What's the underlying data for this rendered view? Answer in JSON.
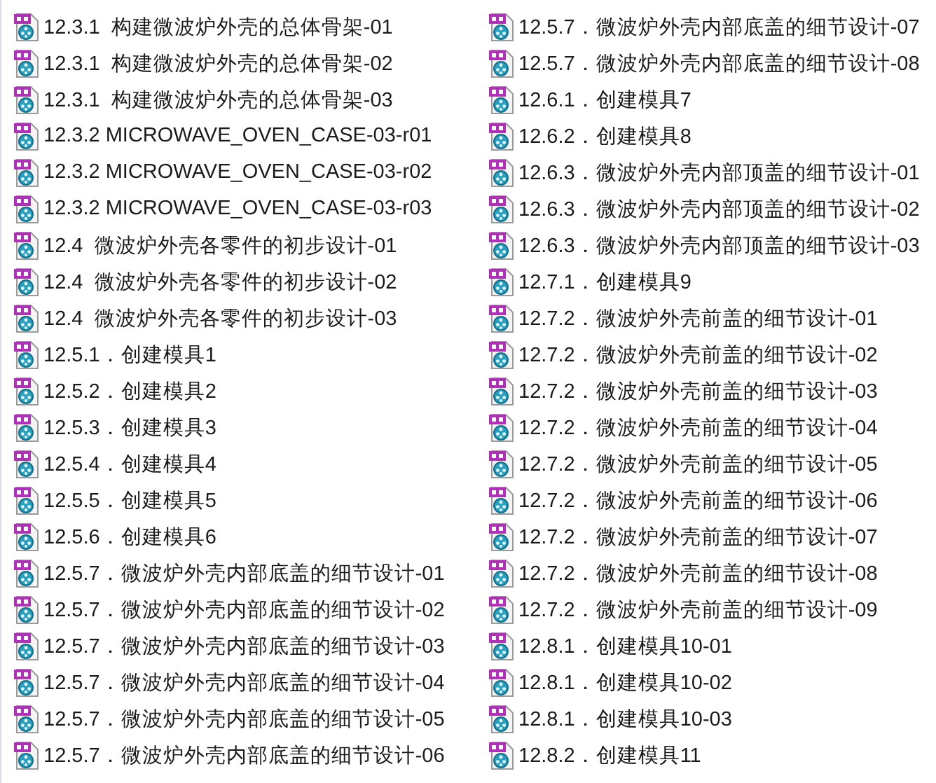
{
  "files": [
    {
      "name": "12.3.1  构建微波炉外壳的总体骨架-01"
    },
    {
      "name": "12.3.1  构建微波炉外壳的总体骨架-02"
    },
    {
      "name": "12.3.1  构建微波炉外壳的总体骨架-03"
    },
    {
      "name": "12.3.2 MICROWAVE_OVEN_CASE-03-r01"
    },
    {
      "name": "12.3.2 MICROWAVE_OVEN_CASE-03-r02"
    },
    {
      "name": "12.3.2 MICROWAVE_OVEN_CASE-03-r03"
    },
    {
      "name": "12.4  微波炉外壳各零件的初步设计-01"
    },
    {
      "name": "12.4  微波炉外壳各零件的初步设计-02"
    },
    {
      "name": "12.4  微波炉外壳各零件的初步设计-03"
    },
    {
      "name": "12.5.1．创建模具1"
    },
    {
      "name": "12.5.2．创建模具2"
    },
    {
      "name": "12.5.3．创建模具3"
    },
    {
      "name": "12.5.4．创建模具4"
    },
    {
      "name": "12.5.5．创建模具5"
    },
    {
      "name": "12.5.6．创建模具6"
    },
    {
      "name": "12.5.7．微波炉外壳内部底盖的细节设计-01"
    },
    {
      "name": "12.5.7．微波炉外壳内部底盖的细节设计-02"
    },
    {
      "name": "12.5.7．微波炉外壳内部底盖的细节设计-03"
    },
    {
      "name": "12.5.7．微波炉外壳内部底盖的细节设计-04"
    },
    {
      "name": "12.5.7．微波炉外壳内部底盖的细节设计-05"
    },
    {
      "name": "12.5.7．微波炉外壳内部底盖的细节设计-06"
    },
    {
      "name": "12.5.7．微波炉外壳内部底盖的细节设计-07"
    },
    {
      "name": "12.5.7．微波炉外壳内部底盖的细节设计-08"
    },
    {
      "name": "12.6.1．创建模具7"
    },
    {
      "name": "12.6.2．创建模具8"
    },
    {
      "name": "12.6.3．微波炉外壳内部顶盖的细节设计-01"
    },
    {
      "name": "12.6.3．微波炉外壳内部顶盖的细节设计-02"
    },
    {
      "name": "12.6.3．微波炉外壳内部顶盖的细节设计-03"
    },
    {
      "name": "12.7.1．创建模具9"
    },
    {
      "name": "12.7.2．微波炉外壳前盖的细节设计-01"
    },
    {
      "name": "12.7.2．微波炉外壳前盖的细节设计-02"
    },
    {
      "name": "12.7.2．微波炉外壳前盖的细节设计-03"
    },
    {
      "name": "12.7.2．微波炉外壳前盖的细节设计-04"
    },
    {
      "name": "12.7.2．微波炉外壳前盖的细节设计-05"
    },
    {
      "name": "12.7.2．微波炉外壳前盖的细节设计-06"
    },
    {
      "name": "12.7.2．微波炉外壳前盖的细节设计-07"
    },
    {
      "name": "12.7.2．微波炉外壳前盖的细节设计-08"
    },
    {
      "name": "12.7.2．微波炉外壳前盖的细节设计-09"
    },
    {
      "name": "12.8.1．创建模具10-01"
    },
    {
      "name": "12.8.1．创建模具10-02"
    },
    {
      "name": "12.8.1．创建模具10-03"
    },
    {
      "name": "12.8.2．创建模具11"
    }
  ]
}
